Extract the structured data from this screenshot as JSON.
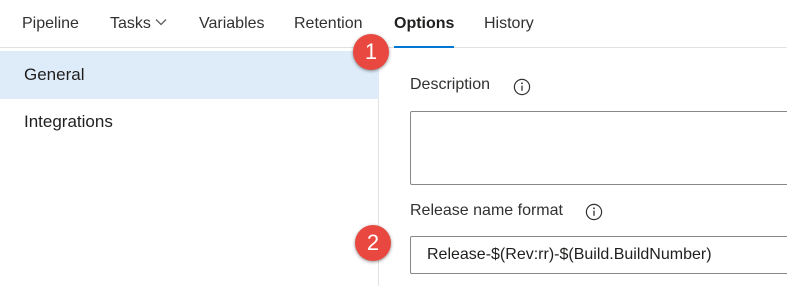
{
  "tabs": [
    {
      "label": "Pipeline"
    },
    {
      "label": "Tasks"
    },
    {
      "label": "Variables"
    },
    {
      "label": "Retention"
    },
    {
      "label": "Options"
    },
    {
      "label": "History"
    }
  ],
  "active_tab": "Options",
  "sidebar": {
    "items": [
      {
        "label": "General",
        "selected": true
      },
      {
        "label": "Integrations",
        "selected": false
      }
    ]
  },
  "form": {
    "description_label": "Description",
    "description_value": "",
    "release_name_label": "Release name format",
    "release_name_value": "Release-$(Rev:rr)-$(Build.BuildNumber)"
  },
  "callouts": [
    {
      "number": "1"
    },
    {
      "number": "2"
    }
  ],
  "colors": {
    "accent": "#0078d4",
    "selected_bg": "#deecf9",
    "callout": "#e8483f"
  },
  "icons": {
    "tasks_dropdown": "chevron-down-icon",
    "field_info": "info-icon"
  }
}
